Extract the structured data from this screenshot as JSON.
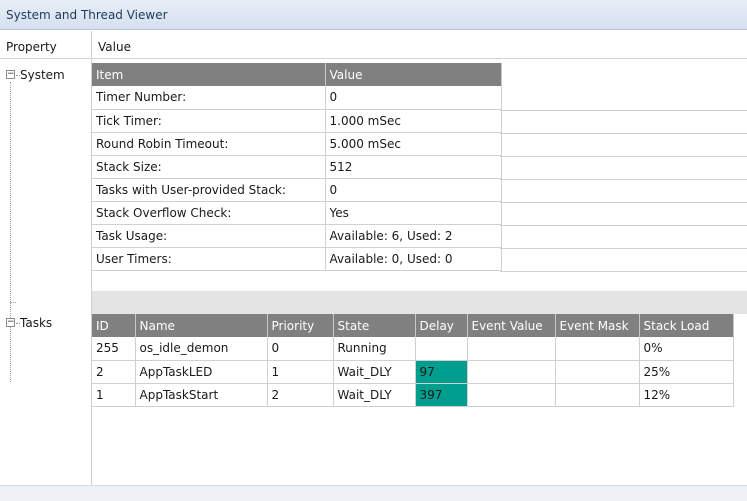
{
  "window": {
    "title": "System and Thread Viewer"
  },
  "columns": {
    "property": "Property",
    "value": "Value"
  },
  "tree": {
    "system_label": "System",
    "tasks_label": "Tasks",
    "expander_symbol": "−"
  },
  "system_table": {
    "headers": [
      "Item",
      "Value"
    ],
    "rows": [
      [
        "Timer Number:",
        "0"
      ],
      [
        "Tick Timer:",
        "1.000 mSec"
      ],
      [
        "Round Robin Timeout:",
        "5.000 mSec"
      ],
      [
        "Stack Size:",
        "512"
      ],
      [
        "Tasks with User-provided Stack:",
        "0"
      ],
      [
        "Stack Overflow Check:",
        "Yes"
      ],
      [
        "Task Usage:",
        "Available: 6, Used: 2"
      ],
      [
        "User Timers:",
        "Available: 0, Used: 0"
      ]
    ]
  },
  "tasks_table": {
    "headers": [
      "ID",
      "Name",
      "Priority",
      "State",
      "Delay",
      "Event Value",
      "Event Mask",
      "Stack Load"
    ],
    "rows": [
      [
        "255",
        "os_idle_demon",
        "0",
        "Running",
        "",
        "",
        "",
        "0%"
      ],
      [
        "2",
        "AppTaskLED",
        "1",
        "Wait_DLY",
        "97",
        "",
        "",
        "25%"
      ],
      [
        "1",
        "AppTaskStart",
        "2",
        "Wait_DLY",
        "397",
        "",
        "",
        "12%"
      ]
    ],
    "highlight_color": "#009e8e"
  }
}
